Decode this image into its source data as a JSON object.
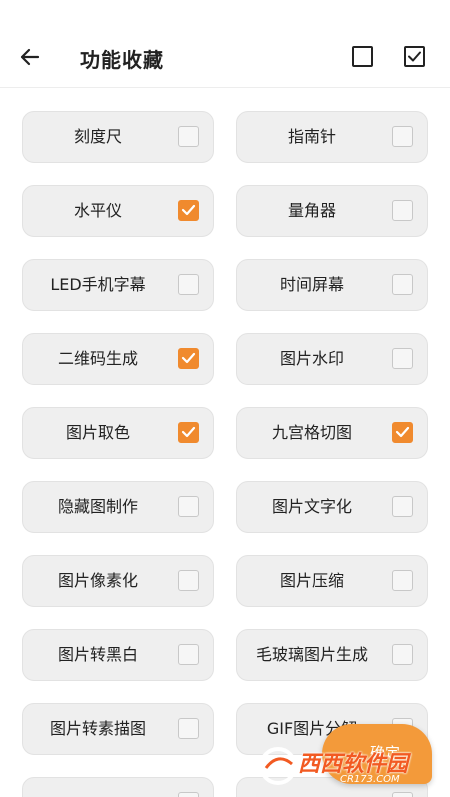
{
  "header": {
    "title": "功能收藏"
  },
  "icons": {
    "back": "arrow-left-icon",
    "deselect_all": "empty-checkbox-icon",
    "select_all": "checked-checkbox-icon"
  },
  "colors": {
    "accent": "#f08a2e",
    "item_bg": "#efefef",
    "watermark": "#f25a22"
  },
  "items": [
    {
      "label": "刻度尺",
      "checked": false
    },
    {
      "label": "指南针",
      "checked": false
    },
    {
      "label": "水平仪",
      "checked": true
    },
    {
      "label": "量角器",
      "checked": false
    },
    {
      "label": "LED手机字幕",
      "checked": false
    },
    {
      "label": "时间屏幕",
      "checked": false
    },
    {
      "label": "二维码生成",
      "checked": true
    },
    {
      "label": "图片水印",
      "checked": false
    },
    {
      "label": "图片取色",
      "checked": true
    },
    {
      "label": "九宫格切图",
      "checked": true
    },
    {
      "label": "隐藏图制作",
      "checked": false
    },
    {
      "label": "图片文字化",
      "checked": false
    },
    {
      "label": "图片像素化",
      "checked": false
    },
    {
      "label": "图片压缩",
      "checked": false
    },
    {
      "label": "图片转黑白",
      "checked": false
    },
    {
      "label": "毛玻璃图片生成",
      "checked": false
    },
    {
      "label": "图片转素描图",
      "checked": false
    },
    {
      "label": "GIF图片分解",
      "checked": false
    },
    {
      "label": "",
      "checked": false
    },
    {
      "label": "",
      "checked": false
    }
  ],
  "confirm_button": {
    "label": "确定"
  },
  "watermark": {
    "text": "西西软件园",
    "sub": "CR173.COM"
  }
}
